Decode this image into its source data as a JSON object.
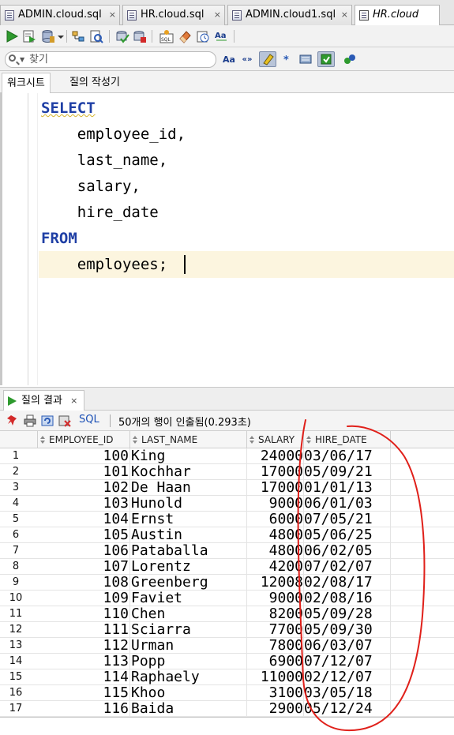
{
  "file_tabs": [
    {
      "label": "ADMIN.cloud.sql",
      "active": false
    },
    {
      "label": "HR.cloud.sql",
      "active": false
    },
    {
      "label": "ADMIN.cloud1.sql",
      "active": false
    },
    {
      "label": "HR.cloud",
      "active": true
    }
  ],
  "tab_close_glyph": "×",
  "toolbar_icons": [
    "run-statement-icon",
    "run-script-icon",
    "commit-icon",
    "dropdown-icon",
    "explain-plan-icon",
    "autotrace-icon",
    "rollback-icon",
    "clear-icon",
    "sql-tuning-icon",
    "eraser-icon",
    "history-icon",
    "format-case-icon"
  ],
  "search": {
    "placeholder": "찾기",
    "value": ""
  },
  "search_buttons": [
    {
      "name": "match-case-button",
      "label": "Aa"
    },
    {
      "name": "whole-word-button",
      "label": "«»"
    }
  ],
  "subtabs": [
    {
      "label": "워크시트",
      "active": true
    },
    {
      "label": "질의 작성기",
      "active": false
    }
  ],
  "editor": {
    "lines": [
      {
        "text": "SELECT",
        "keyword": true
      },
      {
        "text": "    employee_id,",
        "keyword": false
      },
      {
        "text": "    last_name,",
        "keyword": false
      },
      {
        "text": "    salary,",
        "keyword": false
      },
      {
        "text": "    hire_date",
        "keyword": false
      },
      {
        "text": "FROM",
        "keyword": true
      },
      {
        "text": "    employees;",
        "keyword": false
      }
    ]
  },
  "results": {
    "tab_label": "질의 결과",
    "sql_label": "SQL",
    "status": "50개의 행이 인출됨(0.293초)",
    "columns": [
      "EMPLOYEE_ID",
      "LAST_NAME",
      "SALARY",
      "HIRE_DATE"
    ],
    "rows": [
      {
        "n": "1",
        "id": "100",
        "name": "King",
        "salary": "24000",
        "date": "03/06/17"
      },
      {
        "n": "2",
        "id": "101",
        "name": "Kochhar",
        "salary": "17000",
        "date": "05/09/21"
      },
      {
        "n": "3",
        "id": "102",
        "name": "De Haan",
        "salary": "17000",
        "date": "01/01/13"
      },
      {
        "n": "4",
        "id": "103",
        "name": "Hunold",
        "salary": "9000",
        "date": "06/01/03"
      },
      {
        "n": "5",
        "id": "104",
        "name": "Ernst",
        "salary": "6000",
        "date": "07/05/21"
      },
      {
        "n": "6",
        "id": "105",
        "name": "Austin",
        "salary": "4800",
        "date": "05/06/25"
      },
      {
        "n": "7",
        "id": "106",
        "name": "Pataballa",
        "salary": "4800",
        "date": "06/02/05"
      },
      {
        "n": "8",
        "id": "107",
        "name": "Lorentz",
        "salary": "4200",
        "date": "07/02/07"
      },
      {
        "n": "9",
        "id": "108",
        "name": "Greenberg",
        "salary": "12008",
        "date": "02/08/17"
      },
      {
        "n": "10",
        "id": "109",
        "name": "Faviet",
        "salary": "9000",
        "date": "02/08/16"
      },
      {
        "n": "11",
        "id": "110",
        "name": "Chen",
        "salary": "8200",
        "date": "05/09/28"
      },
      {
        "n": "12",
        "id": "111",
        "name": "Sciarra",
        "salary": "7700",
        "date": "05/09/30"
      },
      {
        "n": "13",
        "id": "112",
        "name": "Urman",
        "salary": "7800",
        "date": "06/03/07"
      },
      {
        "n": "14",
        "id": "113",
        "name": "Popp",
        "salary": "6900",
        "date": "07/12/07"
      },
      {
        "n": "15",
        "id": "114",
        "name": "Raphaely",
        "salary": "11000",
        "date": "02/12/07"
      },
      {
        "n": "16",
        "id": "115",
        "name": "Khoo",
        "salary": "3100",
        "date": "03/05/18"
      },
      {
        "n": "17",
        "id": "116",
        "name": "Baida",
        "salary": "2900",
        "date": "05/12/24"
      }
    ]
  },
  "colors": {
    "keyword": "#1f3fa5",
    "current_line": "#fcf5df",
    "annotation_ink": "#e0201a",
    "run_green": "#2e9a2e"
  }
}
